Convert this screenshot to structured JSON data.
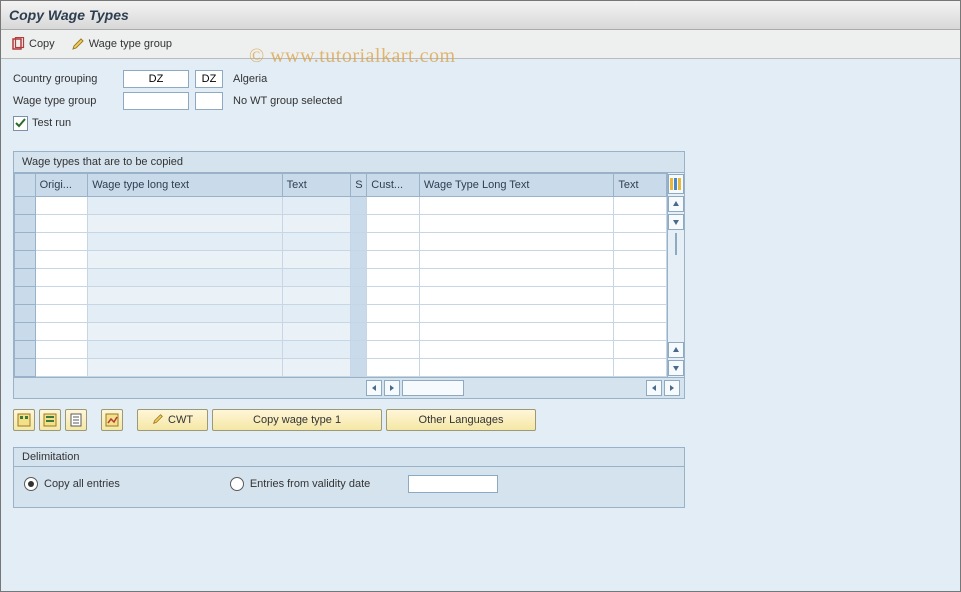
{
  "watermark": "© www.tutorialkart.com",
  "title": "Copy Wage Types",
  "toolbar": {
    "copy_label": "Copy",
    "wt_group_label": "Wage type group"
  },
  "fields": {
    "country_grouping": {
      "label": "Country grouping",
      "value": "DZ",
      "desc": "Algeria"
    },
    "wage_type_group": {
      "label": "Wage type group",
      "value": "",
      "desc": "No WT group selected"
    },
    "test_run": {
      "label": "Test run",
      "checked": true
    }
  },
  "grid": {
    "title": "Wage types that are to be copied",
    "columns_left": [
      "Origi...",
      "Wage type long text",
      "Text"
    ],
    "columns_mid": [
      "S"
    ],
    "columns_right": [
      "Cust...",
      "Wage Type Long Text",
      "Text"
    ],
    "row_count": 10
  },
  "actions": {
    "cwt": "CWT",
    "copy1": "Copy wage type 1",
    "other_lang": "Other Languages"
  },
  "delimitation": {
    "title": "Delimitation",
    "copy_all": "Copy all entries",
    "entries_from": "Entries from validity date",
    "selected": "copy_all",
    "date_value": ""
  }
}
